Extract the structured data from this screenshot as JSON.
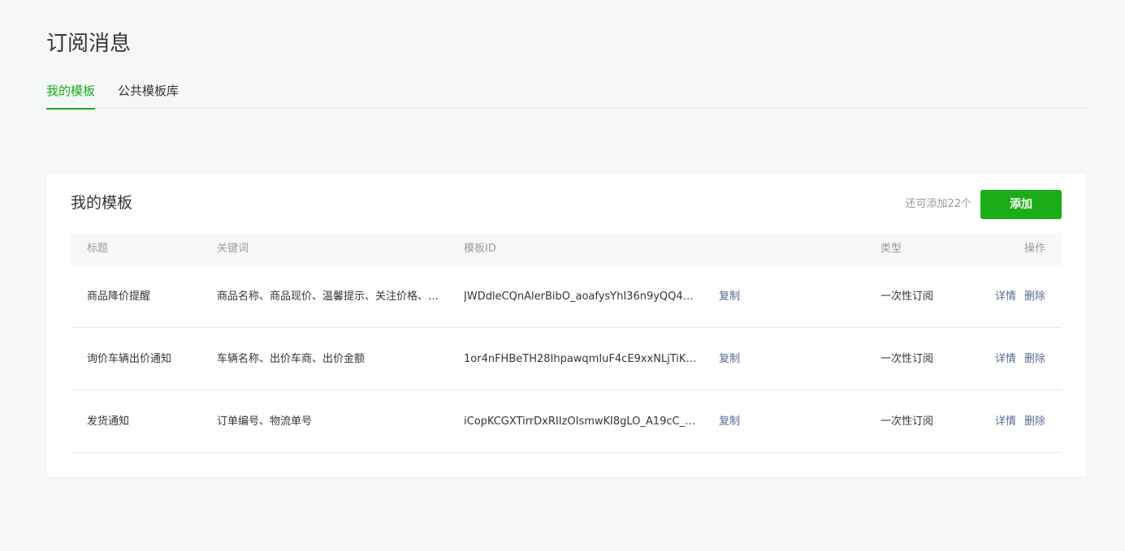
{
  "page": {
    "title": "订阅消息"
  },
  "tabs": [
    {
      "label": "我的模板",
      "active": true
    },
    {
      "label": "公共模板库",
      "active": false
    }
  ],
  "card": {
    "title": "我的模板",
    "remaining": "还可添加22个",
    "add_label": "添加"
  },
  "table": {
    "headers": {
      "title": "标题",
      "keywords": "关键词",
      "template_id": "模板ID",
      "type": "类型",
      "actions": "操作"
    },
    "rows": [
      {
        "title": "商品降价提醒",
        "keywords": "商品名称、商品现价、温馨提示、关注价格、…",
        "template_id": "JWDdleCQnAlerBibO_aoafysYhI36n9yQQ4…",
        "copy": "复制",
        "type": "一次性订阅",
        "detail": "详情",
        "delete": "删除"
      },
      {
        "title": "询价车辆出价通知",
        "keywords": "车辆名称、出价车商、出价金额",
        "template_id": "1or4nFHBeTH28IhpawqmIuF4cE9xxNLjTiK…",
        "copy": "复制",
        "type": "一次性订阅",
        "detail": "详情",
        "delete": "删除"
      },
      {
        "title": "发货通知",
        "keywords": "订单编号、物流单号",
        "template_id": "iCopKCGXTirrDxRIIzOIsmwKI8gLO_A19cC_…",
        "copy": "复制",
        "type": "一次性订阅",
        "detail": "详情",
        "delete": "删除"
      }
    ]
  },
  "colors": {
    "accent": "#1aad19",
    "link": "#576b95",
    "muted": "#9a9a9a"
  }
}
